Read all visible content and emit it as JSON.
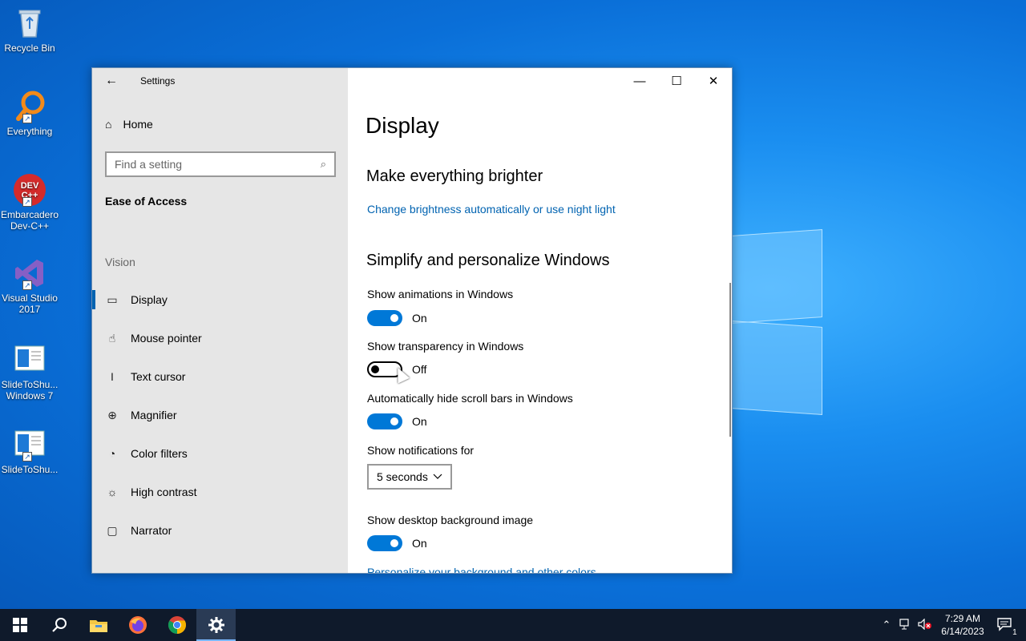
{
  "desktop": {
    "icons": [
      {
        "label": "Recycle Bin",
        "icon": "recycle-bin-icon"
      },
      {
        "label": "Everything",
        "icon": "everything-search-icon"
      },
      {
        "label": "Embarcadero Dev-C++",
        "icon": "devcpp-icon",
        "glyph": "DEV C++"
      },
      {
        "label": "Visual Studio 2017",
        "icon": "visual-studio-icon"
      },
      {
        "label": "SlideToShu... Windows 7",
        "icon": "slidetoshutdown-icon"
      },
      {
        "label": "SlideToShu...",
        "icon": "slidetoshutdown-icon"
      }
    ]
  },
  "window": {
    "title": "Settings",
    "back_icon": "←",
    "caption": {
      "minimize": "—",
      "maximize": "☐",
      "close": "✕"
    }
  },
  "sidebar": {
    "home_label": "Home",
    "home_icon": "⌂",
    "search_placeholder": "Find a setting",
    "search_icon": "⌕",
    "section": "Ease of Access",
    "group": "Vision",
    "items": [
      {
        "label": "Display",
        "icon": "▭",
        "active": true
      },
      {
        "label": "Mouse pointer",
        "icon": "☝"
      },
      {
        "label": "Text cursor",
        "icon": "I"
      },
      {
        "label": "Magnifier",
        "icon": "⊕"
      },
      {
        "label": "Color filters",
        "icon": "◔"
      },
      {
        "label": "High contrast",
        "icon": "☼"
      },
      {
        "label": "Narrator",
        "icon": "▢"
      }
    ]
  },
  "main": {
    "title": "Display",
    "brighter_heading": "Make everything brighter",
    "brightness_link": "Change brightness automatically or use night light",
    "simplify_heading": "Simplify and personalize Windows",
    "animations_label": "Show animations in Windows",
    "animations_state": "On",
    "transparency_label": "Show transparency in Windows",
    "transparency_state": "Off",
    "scrollbars_label": "Automatically hide scroll bars in Windows",
    "scrollbars_state": "On",
    "notifications_label": "Show notifications for",
    "notifications_value": "5 seconds",
    "background_label": "Show desktop background image",
    "background_state": "On",
    "personalize_link": "Personalize your background and other colors"
  },
  "taskbar": {
    "items": [
      "windows-start-icon",
      "search-icon",
      "file-explorer-icon",
      "firefox-icon",
      "chrome-icon",
      "settings-icon"
    ],
    "active_item": "settings-icon",
    "time": "7:29 AM",
    "date": "6/14/2023",
    "notification_count": "1"
  },
  "colors": {
    "accent": "#0078d7",
    "link": "#0063b1",
    "sidebar_bg": "#e6e6e6",
    "taskbar_bg": "#0f1a2b"
  }
}
